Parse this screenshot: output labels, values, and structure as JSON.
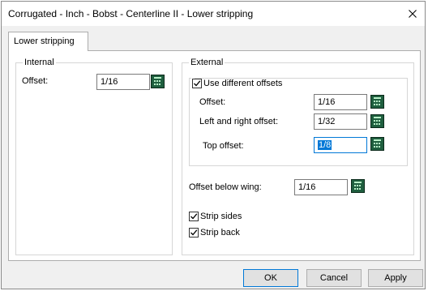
{
  "window": {
    "title": "Corrugated - Inch - Bobst - Centerline II - Lower stripping"
  },
  "tabs": [
    {
      "label": "Lower stripping",
      "active": true
    }
  ],
  "internal": {
    "group_label": "Internal",
    "offset_label": "Offset:",
    "offset_value": "1/16"
  },
  "external": {
    "group_label": "External",
    "use_different_offsets_label": "Use different offsets",
    "use_different_offsets_checked": true,
    "offset_label": "Offset:",
    "offset_value": "1/16",
    "left_right_label": "Left and right offset:",
    "left_right_value": "1/32",
    "top_label": "Top offset:",
    "top_value": "1/8",
    "below_wing_label": "Offset below wing:",
    "below_wing_value": "1/16",
    "strip_sides_label": "Strip sides",
    "strip_sides_checked": true,
    "strip_back_label": "Strip back",
    "strip_back_checked": true
  },
  "buttons": {
    "ok": "OK",
    "cancel": "Cancel",
    "apply": "Apply"
  },
  "icons": {
    "close": "close-icon",
    "calculator": "calculator-icon",
    "checkmark": "checkmark-icon"
  },
  "colors": {
    "accent": "#0078d7",
    "calculator_body": "#1f5f3f"
  }
}
